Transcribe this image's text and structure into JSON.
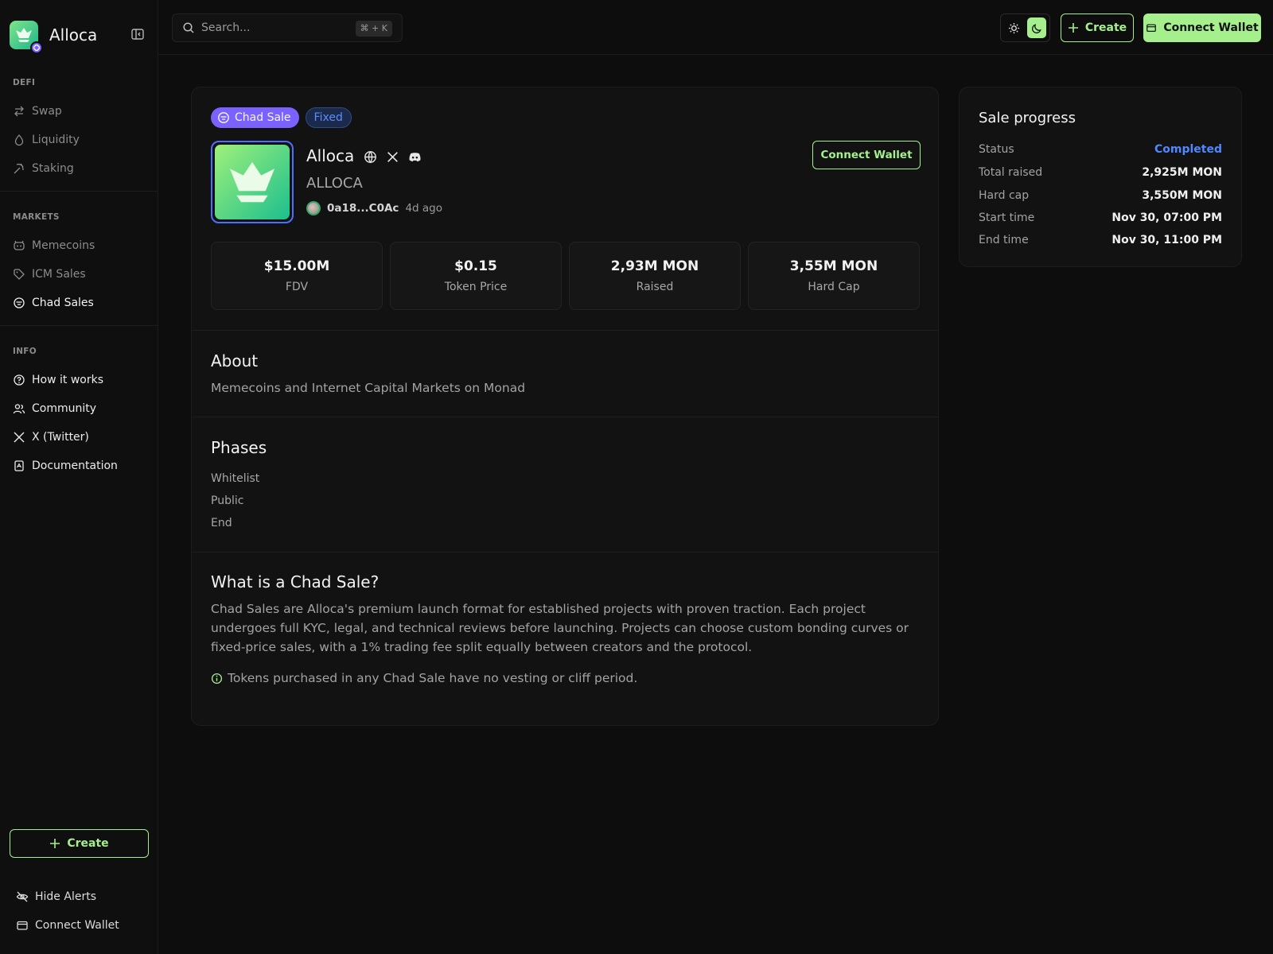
{
  "app": {
    "name": "Alloca"
  },
  "sidebar": {
    "sections": [
      {
        "title": "DEFI",
        "items": [
          {
            "label": "Swap",
            "icon": "swap-icon"
          },
          {
            "label": "Liquidity",
            "icon": "droplet-icon"
          },
          {
            "label": "Staking",
            "icon": "pickaxe-icon"
          }
        ]
      },
      {
        "title": "MARKETS",
        "items": [
          {
            "label": "Memecoins",
            "icon": "memecoin-icon"
          },
          {
            "label": "ICM Sales",
            "icon": "tag-icon"
          },
          {
            "label": "Chad Sales",
            "icon": "chad-mask-icon",
            "active": true
          }
        ]
      },
      {
        "title": "INFO",
        "items": [
          {
            "label": "How it works",
            "icon": "help-circle-icon"
          },
          {
            "label": "Community",
            "icon": "users-icon"
          },
          {
            "label": "X (Twitter)",
            "icon": "x-logo-icon"
          },
          {
            "label": "Documentation",
            "icon": "book-icon"
          }
        ]
      }
    ],
    "create_label": "Create",
    "hide_alerts_label": "Hide Alerts",
    "connect_wallet_label": "Connect Wallet"
  },
  "topbar": {
    "search_placeholder": "Search...",
    "search_shortcut": "⌘ + K",
    "create_label": "Create",
    "connect_wallet_label": "Connect Wallet",
    "theme": "dark"
  },
  "sale": {
    "tags": {
      "type": "Chad Sale",
      "pricing": "Fixed"
    },
    "name": "Alloca",
    "ticker": "ALLOCA",
    "creator_address": "0a18...C0Ac",
    "created_ago": "4d ago",
    "connect_wallet_label": "Connect Wallet",
    "stats": [
      {
        "value": "$15.00M",
        "label": "FDV"
      },
      {
        "value": "$0.15",
        "label": "Token Price"
      },
      {
        "value": "2,93M MON",
        "label": "Raised"
      },
      {
        "value": "3,55M MON",
        "label": "Hard Cap"
      }
    ],
    "about": {
      "title": "About",
      "text": "Memecoins and Internet Capital Markets on Monad"
    },
    "phases": {
      "title": "Phases",
      "items": [
        "Whitelist",
        "Public",
        "End"
      ]
    },
    "what_is": {
      "title": "What is a Chad Sale?",
      "text": "Chad Sales are Alloca's premium launch format for established projects with proven traction. Each project undergoes full KYC, legal, and technical reviews before launching. Projects can choose custom bonding curves or fixed-price sales, with a 1% trading fee split equally between creators and the protocol.",
      "note": "Tokens purchased in any Chad Sale have no vesting or cliff period."
    }
  },
  "progress": {
    "title": "Sale progress",
    "rows": [
      {
        "key": "Status",
        "value": "Completed"
      },
      {
        "key": "Total raised",
        "value": "2,925M MON"
      },
      {
        "key": "Hard cap",
        "value": "3,550M MON"
      },
      {
        "key": "Start time",
        "value": "Nov 30, 07:00 PM"
      },
      {
        "key": "End time",
        "value": "Nov 30, 11:00 PM"
      }
    ]
  },
  "colors": {
    "accent": "#a5f08c",
    "purple": "#7b61ff",
    "status_blue": "#4f88ff",
    "background": "#0d0d0d"
  }
}
